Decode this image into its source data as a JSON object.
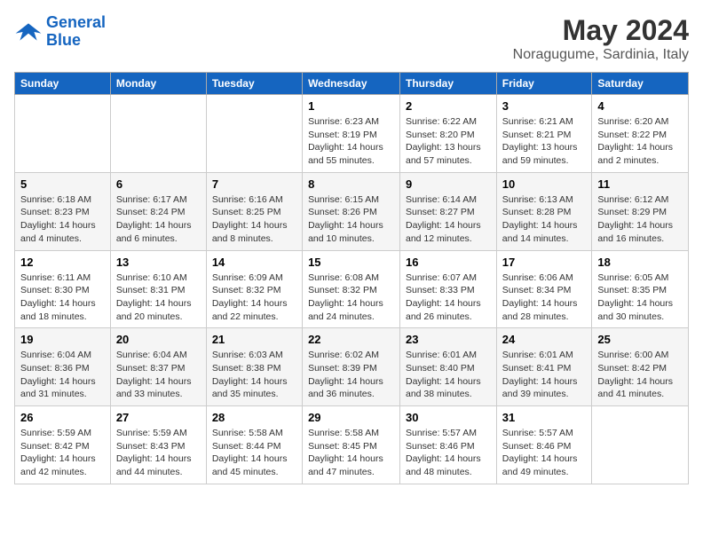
{
  "header": {
    "logo_line1": "General",
    "logo_line2": "Blue",
    "month": "May 2024",
    "location": "Noragugume, Sardinia, Italy"
  },
  "weekdays": [
    "Sunday",
    "Monday",
    "Tuesday",
    "Wednesday",
    "Thursday",
    "Friday",
    "Saturday"
  ],
  "weeks": [
    [
      {
        "day": "",
        "sunrise": "",
        "sunset": "",
        "daylight": ""
      },
      {
        "day": "",
        "sunrise": "",
        "sunset": "",
        "daylight": ""
      },
      {
        "day": "",
        "sunrise": "",
        "sunset": "",
        "daylight": ""
      },
      {
        "day": "1",
        "sunrise": "Sunrise: 6:23 AM",
        "sunset": "Sunset: 8:19 PM",
        "daylight": "Daylight: 14 hours and 55 minutes."
      },
      {
        "day": "2",
        "sunrise": "Sunrise: 6:22 AM",
        "sunset": "Sunset: 8:20 PM",
        "daylight": "Daylight: 13 hours and 57 minutes."
      },
      {
        "day": "3",
        "sunrise": "Sunrise: 6:21 AM",
        "sunset": "Sunset: 8:21 PM",
        "daylight": "Daylight: 13 hours and 59 minutes."
      },
      {
        "day": "4",
        "sunrise": "Sunrise: 6:20 AM",
        "sunset": "Sunset: 8:22 PM",
        "daylight": "Daylight: 14 hours and 2 minutes."
      }
    ],
    [
      {
        "day": "5",
        "sunrise": "Sunrise: 6:18 AM",
        "sunset": "Sunset: 8:23 PM",
        "daylight": "Daylight: 14 hours and 4 minutes."
      },
      {
        "day": "6",
        "sunrise": "Sunrise: 6:17 AM",
        "sunset": "Sunset: 8:24 PM",
        "daylight": "Daylight: 14 hours and 6 minutes."
      },
      {
        "day": "7",
        "sunrise": "Sunrise: 6:16 AM",
        "sunset": "Sunset: 8:25 PM",
        "daylight": "Daylight: 14 hours and 8 minutes."
      },
      {
        "day": "8",
        "sunrise": "Sunrise: 6:15 AM",
        "sunset": "Sunset: 8:26 PM",
        "daylight": "Daylight: 14 hours and 10 minutes."
      },
      {
        "day": "9",
        "sunrise": "Sunrise: 6:14 AM",
        "sunset": "Sunset: 8:27 PM",
        "daylight": "Daylight: 14 hours and 12 minutes."
      },
      {
        "day": "10",
        "sunrise": "Sunrise: 6:13 AM",
        "sunset": "Sunset: 8:28 PM",
        "daylight": "Daylight: 14 hours and 14 minutes."
      },
      {
        "day": "11",
        "sunrise": "Sunrise: 6:12 AM",
        "sunset": "Sunset: 8:29 PM",
        "daylight": "Daylight: 14 hours and 16 minutes."
      }
    ],
    [
      {
        "day": "12",
        "sunrise": "Sunrise: 6:11 AM",
        "sunset": "Sunset: 8:30 PM",
        "daylight": "Daylight: 14 hours and 18 minutes."
      },
      {
        "day": "13",
        "sunrise": "Sunrise: 6:10 AM",
        "sunset": "Sunset: 8:31 PM",
        "daylight": "Daylight: 14 hours and 20 minutes."
      },
      {
        "day": "14",
        "sunrise": "Sunrise: 6:09 AM",
        "sunset": "Sunset: 8:32 PM",
        "daylight": "Daylight: 14 hours and 22 minutes."
      },
      {
        "day": "15",
        "sunrise": "Sunrise: 6:08 AM",
        "sunset": "Sunset: 8:32 PM",
        "daylight": "Daylight: 14 hours and 24 minutes."
      },
      {
        "day": "16",
        "sunrise": "Sunrise: 6:07 AM",
        "sunset": "Sunset: 8:33 PM",
        "daylight": "Daylight: 14 hours and 26 minutes."
      },
      {
        "day": "17",
        "sunrise": "Sunrise: 6:06 AM",
        "sunset": "Sunset: 8:34 PM",
        "daylight": "Daylight: 14 hours and 28 minutes."
      },
      {
        "day": "18",
        "sunrise": "Sunrise: 6:05 AM",
        "sunset": "Sunset: 8:35 PM",
        "daylight": "Daylight: 14 hours and 30 minutes."
      }
    ],
    [
      {
        "day": "19",
        "sunrise": "Sunrise: 6:04 AM",
        "sunset": "Sunset: 8:36 PM",
        "daylight": "Daylight: 14 hours and 31 minutes."
      },
      {
        "day": "20",
        "sunrise": "Sunrise: 6:04 AM",
        "sunset": "Sunset: 8:37 PM",
        "daylight": "Daylight: 14 hours and 33 minutes."
      },
      {
        "day": "21",
        "sunrise": "Sunrise: 6:03 AM",
        "sunset": "Sunset: 8:38 PM",
        "daylight": "Daylight: 14 hours and 35 minutes."
      },
      {
        "day": "22",
        "sunrise": "Sunrise: 6:02 AM",
        "sunset": "Sunset: 8:39 PM",
        "daylight": "Daylight: 14 hours and 36 minutes."
      },
      {
        "day": "23",
        "sunrise": "Sunrise: 6:01 AM",
        "sunset": "Sunset: 8:40 PM",
        "daylight": "Daylight: 14 hours and 38 minutes."
      },
      {
        "day": "24",
        "sunrise": "Sunrise: 6:01 AM",
        "sunset": "Sunset: 8:41 PM",
        "daylight": "Daylight: 14 hours and 39 minutes."
      },
      {
        "day": "25",
        "sunrise": "Sunrise: 6:00 AM",
        "sunset": "Sunset: 8:42 PM",
        "daylight": "Daylight: 14 hours and 41 minutes."
      }
    ],
    [
      {
        "day": "26",
        "sunrise": "Sunrise: 5:59 AM",
        "sunset": "Sunset: 8:42 PM",
        "daylight": "Daylight: 14 hours and 42 minutes."
      },
      {
        "day": "27",
        "sunrise": "Sunrise: 5:59 AM",
        "sunset": "Sunset: 8:43 PM",
        "daylight": "Daylight: 14 hours and 44 minutes."
      },
      {
        "day": "28",
        "sunrise": "Sunrise: 5:58 AM",
        "sunset": "Sunset: 8:44 PM",
        "daylight": "Daylight: 14 hours and 45 minutes."
      },
      {
        "day": "29",
        "sunrise": "Sunrise: 5:58 AM",
        "sunset": "Sunset: 8:45 PM",
        "daylight": "Daylight: 14 hours and 47 minutes."
      },
      {
        "day": "30",
        "sunrise": "Sunrise: 5:57 AM",
        "sunset": "Sunset: 8:46 PM",
        "daylight": "Daylight: 14 hours and 48 minutes."
      },
      {
        "day": "31",
        "sunrise": "Sunrise: 5:57 AM",
        "sunset": "Sunset: 8:46 PM",
        "daylight": "Daylight: 14 hours and 49 minutes."
      },
      {
        "day": "",
        "sunrise": "",
        "sunset": "",
        "daylight": ""
      }
    ]
  ]
}
